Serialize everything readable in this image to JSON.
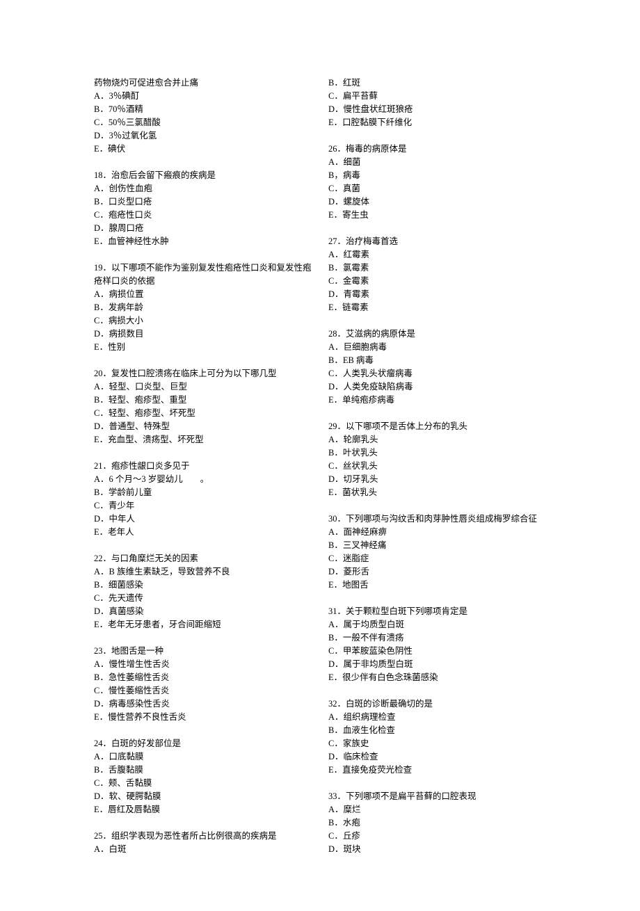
{
  "left": [
    {
      "stem": "药物烧灼可促进愈合并止痛",
      "options": [
        "A．3％碘酊",
        "B．70％酒精",
        "C．50％三氯醋酸",
        "D．3％过氧化氢",
        "E．碘伏"
      ]
    },
    {
      "stem": "18．治愈后会留下瘢痕的疾病是",
      "options": [
        "A．创伤性血疱",
        "B．口炎型口疮",
        "C．疱疮性口炎",
        "D．腺周口疮",
        "E．血管神经性水肿"
      ]
    },
    {
      "stem": "19．以下哪项不能作为鉴别复发性疱疮性口炎和复发性疱疮样口炎的依据",
      "options": [
        "A．病损位置",
        "B．发病年龄",
        "C．病损大小",
        "D．病损数目",
        "E．性别"
      ]
    },
    {
      "stem": "20．复发性口腔溃疡在临床上可分为以下哪几型",
      "options": [
        "A．轻型、口炎型、巨型",
        "B．轻型、疱疹型、重型",
        "C．轻型、疱疹型、坏死型",
        "D．普通型、特殊型",
        "E．充血型、溃疡型、坏死型"
      ]
    },
    {
      "stem": "21．疱疹性龈口炎多见于",
      "options": [
        "A．6 个月～3 岁婴幼儿　　。",
        "B．学龄前儿童",
        "C．青少年",
        "D．中年人",
        "E．老年人"
      ]
    },
    {
      "stem": "22．与口角糜烂无关的因素",
      "options": [
        "A．B 族维生素缺乏，导致营养不良",
        "B．细菌感染",
        "C．先天遗传",
        "D．真菌感染",
        "E．老年无牙患者，牙合间距缩短"
      ]
    },
    {
      "stem": "23．地图舌是一种",
      "options": [
        "A．慢性增生性舌炎",
        "B．急性萎缩性舌炎",
        "C．慢性萎缩性舌炎",
        "D．病毒感染性舌炎",
        "E．慢性营养不良性舌炎"
      ]
    },
    {
      "stem": "24．白斑的好发部位是",
      "options": [
        "A．口底黏膜",
        "B．舌腹黏膜",
        "C．颊、舌黏膜",
        "D．软、硬腭黏膜",
        "E．唇红及唇黏膜"
      ]
    },
    {
      "stem": "25．组织学表现为恶性者所占比例很高的疾病是",
      "options": [
        "A．白斑"
      ]
    }
  ],
  "right": [
    {
      "stem": "",
      "options": [
        "B．红斑",
        "C．扁平苔藓",
        "D．慢性盘状红斑狼疮",
        "E．口腔黏膜下纤维化"
      ]
    },
    {
      "stem": "26．梅毒的病原体是",
      "options": [
        "A．细菌",
        "B，病毒",
        "C．真菌",
        "D．螺旋体",
        "E．寄生虫"
      ]
    },
    {
      "stem": "27．治疗梅毒首选",
      "options": [
        "A．红霉素",
        "B．氯霉素",
        "C．金霉素",
        "D．青霉素",
        "E．链霉素"
      ]
    },
    {
      "stem": "28．艾滋病的病原体是",
      "options": [
        "A．巨细胞病毒",
        "B．EB 病毒",
        "C．人类乳头状瘤病毒",
        "D．人类免疫缺陷病毒",
        "E．单纯疱疹病毒"
      ]
    },
    {
      "stem": "29．以下哪项不是舌体上分布的乳头",
      "options": [
        "A．轮廓乳头",
        "B．叶状乳头",
        "C．丝状乳头",
        "D．切牙乳头",
        "E．菌状乳头"
      ]
    },
    {
      "stem": "30．下列哪项与沟纹舌和肉芽肿性唇炎组成梅罗综合征",
      "options": [
        "A．面神经麻痹",
        "B．三叉神经痛",
        "C．迷脂症",
        "D．菱形舌",
        "E．地图舌"
      ]
    },
    {
      "stem": "31．关于颗粒型白斑下列哪项肯定是",
      "options": [
        "A．属于均质型白斑",
        "B．一般不伴有溃疡",
        "C．甲苯胺蓝染色阴性",
        "D．属于非均质型白斑",
        "E．很少伴有白色念珠菌感染"
      ]
    },
    {
      "stem": "32．白斑的诊断最确切的是",
      "options": [
        "A．组织病理检查",
        "B．血液生化检查",
        "C．家族史",
        "D．临床检查",
        "E．直接免疫荧光检查"
      ]
    },
    {
      "stem": "33．下列哪项不是扁平苔藓的口腔表现",
      "options": [
        "A．糜烂",
        "B．水疱",
        "C．丘疹",
        "D．斑块"
      ]
    }
  ]
}
